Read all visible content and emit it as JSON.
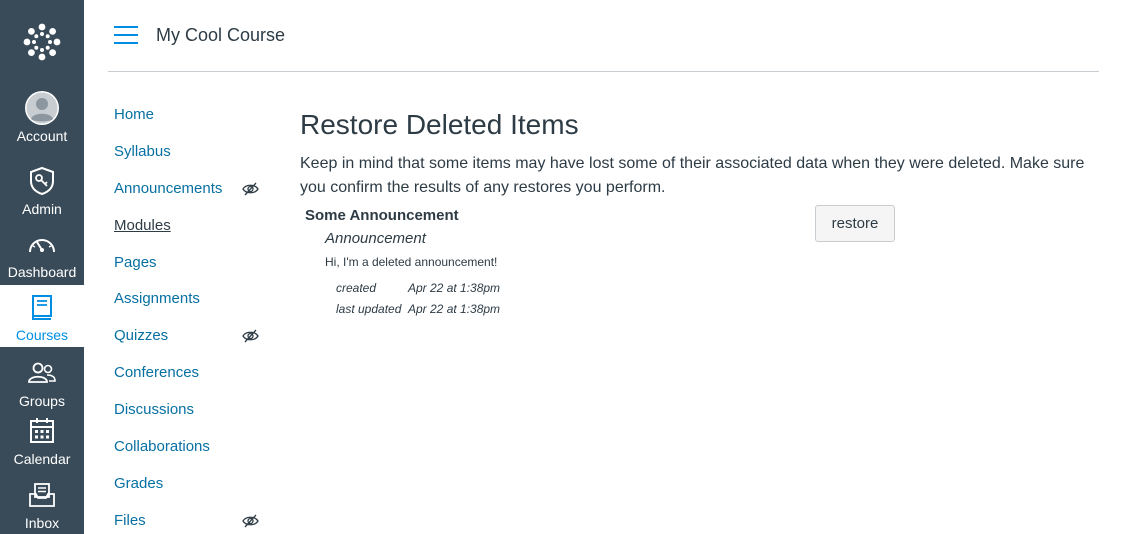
{
  "global_nav": {
    "items": [
      {
        "label": "Account",
        "icon": "account-icon"
      },
      {
        "label": "Admin",
        "icon": "admin-icon"
      },
      {
        "label": "Dashboard",
        "icon": "dashboard-icon"
      },
      {
        "label": "Courses",
        "icon": "courses-icon",
        "active": true
      },
      {
        "label": "Groups",
        "icon": "groups-icon"
      },
      {
        "label": "Calendar",
        "icon": "calendar-icon"
      },
      {
        "label": "Inbox",
        "icon": "inbox-icon"
      }
    ]
  },
  "header": {
    "course_title": "My Cool Course"
  },
  "course_nav": {
    "items": [
      {
        "label": "Home"
      },
      {
        "label": "Syllabus"
      },
      {
        "label": "Announcements",
        "hidden_icon": true
      },
      {
        "label": "Modules",
        "active": true
      },
      {
        "label": "Pages"
      },
      {
        "label": "Assignments"
      },
      {
        "label": "Quizzes",
        "hidden_icon": true
      },
      {
        "label": "Conferences"
      },
      {
        "label": "Discussions"
      },
      {
        "label": "Collaborations"
      },
      {
        "label": "Grades"
      },
      {
        "label": "Files",
        "hidden_icon": true
      }
    ]
  },
  "main": {
    "title": "Restore Deleted Items",
    "intro": "Keep in mind that some items may have lost some of their associated data when they were deleted. Make sure you confirm the results of any restores you perform.",
    "item": {
      "name": "Some Announcement",
      "type": "Announcement",
      "body": "Hi, I'm a deleted announcement!",
      "created_label": "created",
      "created_value": "Apr 22 at 1:38pm",
      "updated_label": "last updated",
      "updated_value": "Apr 22 at 1:38pm",
      "restore_label": "restore"
    }
  },
  "colors": {
    "nav_bg": "#394b58",
    "link": "#0770a3",
    "accent": "#008ee2",
    "text": "#2d3b45"
  }
}
